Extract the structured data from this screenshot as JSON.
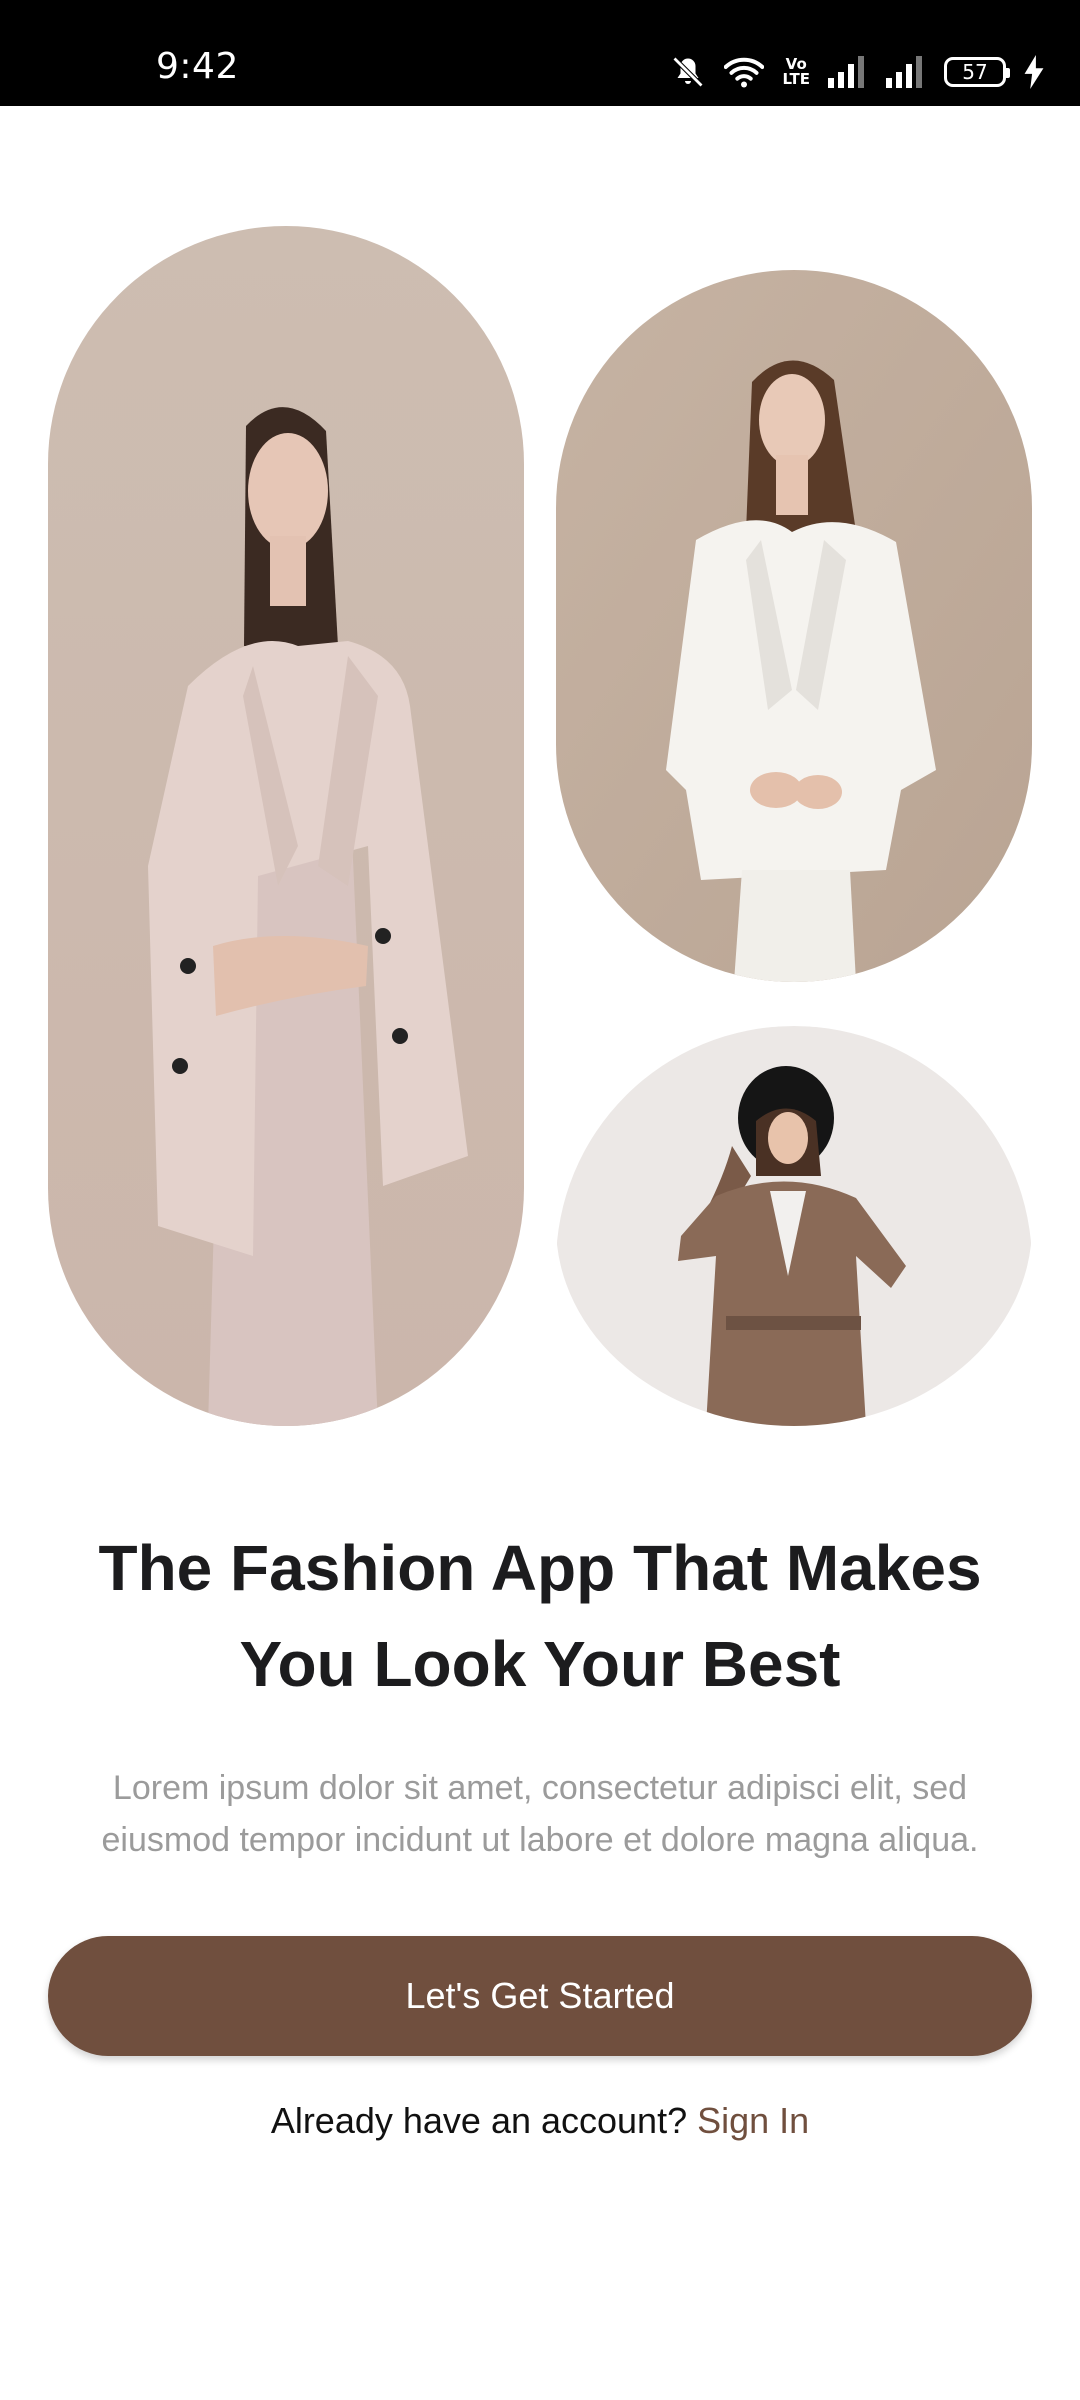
{
  "status_bar": {
    "time": "9:42",
    "battery_level": "57",
    "network_label": "Vo LTE",
    "icons": [
      "mute-bell-icon",
      "wifi-icon",
      "volte-icon",
      "signal-icon",
      "signal-icon",
      "battery-icon",
      "charging-icon"
    ]
  },
  "collage": {
    "images": [
      {
        "name": "model-in-blush-blazer",
        "shape": "capsule"
      },
      {
        "name": "model-in-white-suit",
        "shape": "capsule"
      },
      {
        "name": "model-in-leather-trench-and-hat",
        "shape": "oval"
      }
    ]
  },
  "onboarding": {
    "headline": "The Fashion App That Makes You Look Your Best",
    "description": "Lorem ipsum dolor sit amet, consectetur adipisci elit, sed eiusmod tempor incidunt ut labore et dolore magna aliqua.",
    "cta_label": "Let's Get Started",
    "signin_prompt": "Already have an account? ",
    "signin_link": "Sign In"
  },
  "colors": {
    "accent": "#704f3e",
    "headline": "#1c1c1e",
    "muted_text": "#9b9b9b",
    "background": "#ffffff"
  }
}
